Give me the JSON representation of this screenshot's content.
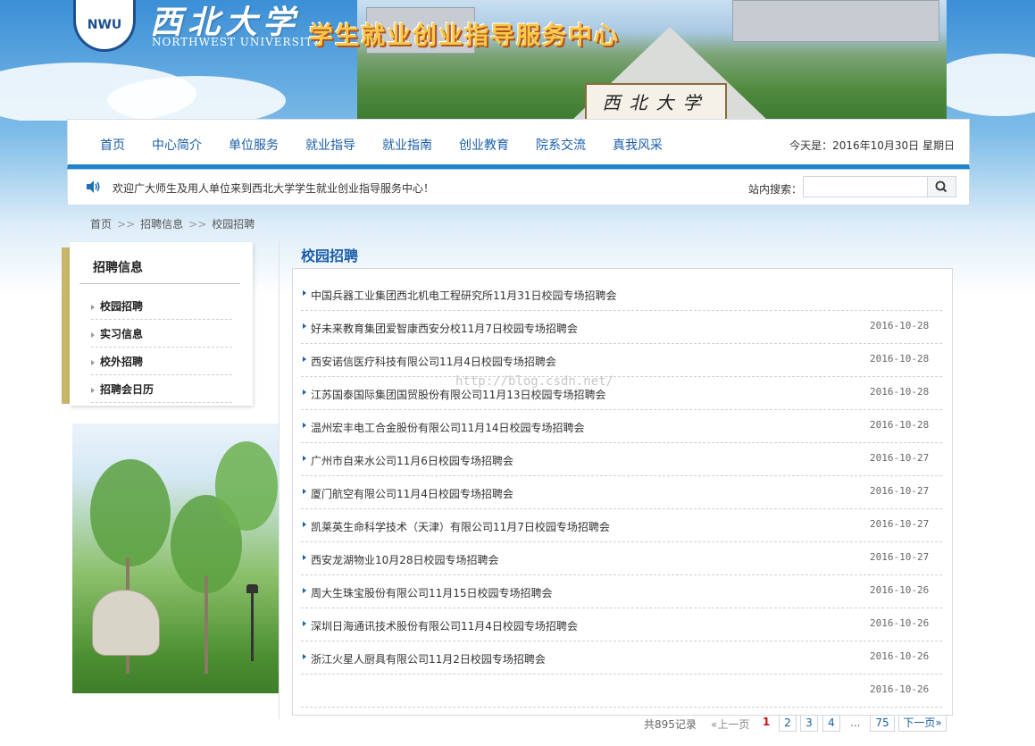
{
  "header": {
    "logo_cn": "西北大学",
    "logo_en": "NORTHWEST UNIVERSITY",
    "site_title": "学生就业创业指导服务中心",
    "gate_sign": "西北大学"
  },
  "nav": {
    "items": [
      "首页",
      "中心简介",
      "单位服务",
      "就业指导",
      "就业指南",
      "创业教育",
      "院系交流",
      "真我风采"
    ],
    "date_text": "今天是：2016年10月30日 星期日"
  },
  "notice": {
    "icon": "speaker-icon",
    "text": "欢迎广大师生及用人单位来到西北大学学生就业创业指导服务中心！",
    "search_label": "站内搜索：",
    "search_value": "",
    "search_icon": "search-icon"
  },
  "breadcrumb": [
    "首页",
    "招聘信息",
    "校园招聘"
  ],
  "sidebar": {
    "title": "招聘信息",
    "items": [
      "校园招聘",
      "实习信息",
      "校外招聘",
      "招聘会日历"
    ]
  },
  "main": {
    "title": "校园招聘",
    "watermark": "http://blog.csdn.net/",
    "rows": [
      {
        "title": "中国兵器工业集团西北机电工程研究所11月31日校园专场招聘会",
        "date": ""
      },
      {
        "title": "好未来教育集团爱智康西安分校11月7日校园专场招聘会",
        "date": "2016-10-28"
      },
      {
        "title": "西安诺信医疗科技有限公司11月4日校园专场招聘会",
        "date": "2016-10-28"
      },
      {
        "title": "江苏国泰国际集团国贸股份有限公司11月13日校园专场招聘会",
        "date": "2016-10-28"
      },
      {
        "title": "温州宏丰电工合金股份有限公司11月14日校园专场招聘会",
        "date": "2016-10-28"
      },
      {
        "title": "广州市自来水公司11月6日校园专场招聘会",
        "date": "2016-10-27"
      },
      {
        "title": "厦门航空有限公司11月4日校园专场招聘会",
        "date": "2016-10-27"
      },
      {
        "title": "凯莱英生命科学技术（天津）有限公司11月7日校园专场招聘会",
        "date": "2016-10-27"
      },
      {
        "title": "西安龙湖物业10月28日校园专场招聘会",
        "date": "2016-10-27"
      },
      {
        "title": "周大生珠宝股份有限公司11月15日校园专场招聘会",
        "date": "2016-10-26"
      },
      {
        "title": "深圳日海通讯技术股份有限公司11月4日校园专场招聘会",
        "date": "2016-10-26"
      },
      {
        "title": "浙江火星人厨具有限公司11月2日校园专场招聘会",
        "date": "2016-10-26"
      },
      {
        "title": "",
        "date": "2016-10-26"
      }
    ]
  },
  "pager": {
    "total": "共895记录",
    "prev": "«上一页",
    "pages": [
      "1",
      "2",
      "3",
      "4"
    ],
    "current": "1",
    "ellipsis": "...",
    "last": "75",
    "next": "下一页»"
  }
}
